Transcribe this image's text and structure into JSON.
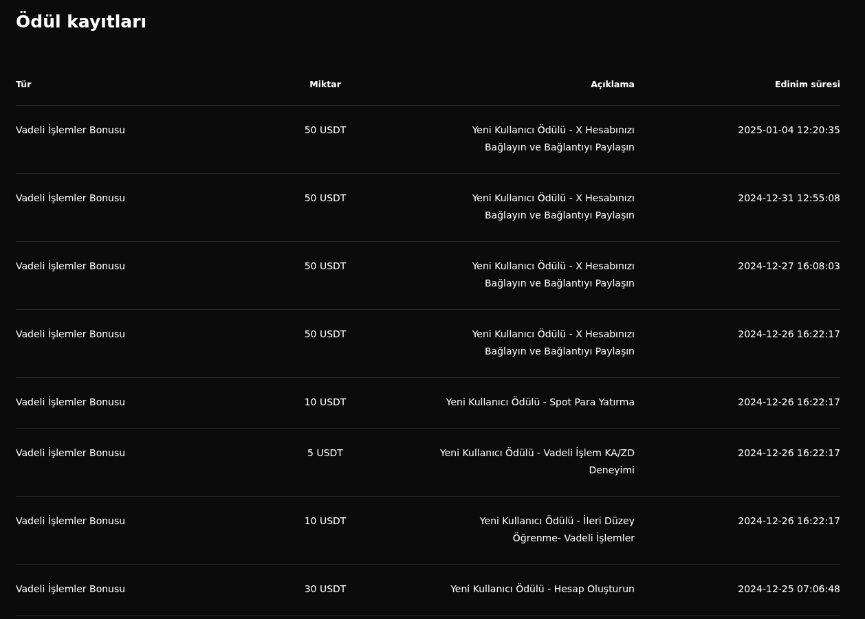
{
  "title": "Ödül kayıtları",
  "table": {
    "columns": [
      "Tür",
      "Miktar",
      "Açıklama",
      "Edinim süresi"
    ],
    "rows": [
      {
        "type": "Vadeli İşlemler Bonusu",
        "amount": "50 USDT",
        "description": [
          "Yeni Kullanıcı Ödülü - X Hesabınızı",
          "Bağlayın ve Bağlantıyı Paylaşın"
        ],
        "time": "2025-01-04 12:20:35"
      },
      {
        "type": "Vadeli İşlemler Bonusu",
        "amount": "50 USDT",
        "description": [
          "Yeni Kullanıcı Ödülü - X Hesabınızı",
          "Bağlayın ve Bağlantıyı Paylaşın"
        ],
        "time": "2024-12-31 12:55:08"
      },
      {
        "type": "Vadeli İşlemler Bonusu",
        "amount": "50 USDT",
        "description": [
          "Yeni Kullanıcı Ödülü - X Hesabınızı",
          "Bağlayın ve Bağlantıyı Paylaşın"
        ],
        "time": "2024-12-27 16:08:03"
      },
      {
        "type": "Vadeli İşlemler Bonusu",
        "amount": "50 USDT",
        "description": [
          "Yeni Kullanıcı Ödülü - X Hesabınızı",
          "Bağlayın ve Bağlantıyı Paylaşın"
        ],
        "time": "2024-12-26 16:22:17"
      },
      {
        "type": "Vadeli İşlemler Bonusu",
        "amount": "10 USDT",
        "description": [
          "Yeni Kullanıcı Ödülü - Spot Para Yatırma"
        ],
        "time": "2024-12-26 16:22:17"
      },
      {
        "type": "Vadeli İşlemler Bonusu",
        "amount": "5 USDT",
        "description": [
          "Yeni Kullanıcı Ödülü - Vadeli İşlem KA/ZD",
          "Deneyimi"
        ],
        "time": "2024-12-26 16:22:17"
      },
      {
        "type": "Vadeli İşlemler Bonusu",
        "amount": "10 USDT",
        "description": [
          "Yeni Kullanıcı Ödülü - İleri Düzey",
          "Öğrenme- Vadeli İşlemler"
        ],
        "time": "2024-12-26 16:22:17"
      },
      {
        "type": "Vadeli İşlemler Bonusu",
        "amount": "30 USDT",
        "description": [
          "Yeni Kullanıcı Ödülü - Hesap Oluşturun"
        ],
        "time": "2024-12-25 07:06:48"
      }
    ]
  }
}
